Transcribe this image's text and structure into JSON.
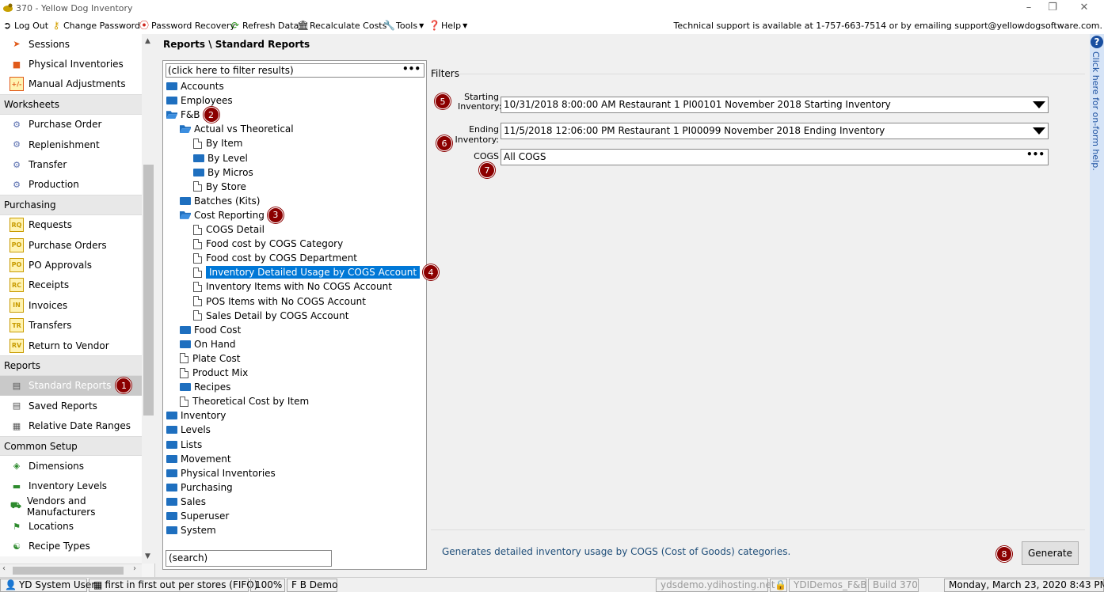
{
  "window": {
    "title": "370  - Yellow Dog Inventory"
  },
  "toolbar": {
    "logout": "Log Out",
    "change_password": "Change Password",
    "password_recovery": "Password Recovery",
    "refresh_data": "Refresh Data",
    "recalculate_costs": "Recalculate Costs",
    "tools": "Tools",
    "help": "Help",
    "support_text": "Technical support is available at 1-757-663-7514 or by emailing support@yellowdogsoftware.com."
  },
  "sidebar": {
    "items": [
      {
        "type": "item",
        "label": "Sessions",
        "icon": "arrow-icon",
        "color": "#e05a1a"
      },
      {
        "type": "item",
        "label": "Physical Inventories",
        "icon": "clipboard-icon",
        "color": "#e05a1a"
      },
      {
        "type": "item",
        "label": "Manual Adjustments",
        "icon": "plus-minus-icon",
        "color": "#e05a1a"
      },
      {
        "type": "header",
        "label": "Worksheets"
      },
      {
        "type": "item",
        "label": "Purchase Order",
        "icon": "worksheet-icon",
        "color": "#5a6fb0"
      },
      {
        "type": "item",
        "label": "Replenishment",
        "icon": "worksheet-icon",
        "color": "#5a6fb0"
      },
      {
        "type": "item",
        "label": "Transfer",
        "icon": "worksheet-icon",
        "color": "#5a6fb0"
      },
      {
        "type": "item",
        "label": "Production",
        "icon": "worksheet-icon",
        "color": "#5a6fb0"
      },
      {
        "type": "header",
        "label": "Purchasing"
      },
      {
        "type": "item",
        "label": "Requests",
        "icon": "rq-icon",
        "color": "#c89b00"
      },
      {
        "type": "item",
        "label": "Purchase Orders",
        "icon": "po-icon",
        "color": "#c89b00"
      },
      {
        "type": "item",
        "label": "PO Approvals",
        "icon": "po-approve-icon",
        "color": "#c89b00"
      },
      {
        "type": "item",
        "label": "Receipts",
        "icon": "rc-icon",
        "color": "#c89b00"
      },
      {
        "type": "item",
        "label": "Invoices",
        "icon": "in-icon",
        "color": "#c89b00"
      },
      {
        "type": "item",
        "label": "Transfers",
        "icon": "tr-icon",
        "color": "#c89b00"
      },
      {
        "type": "item",
        "label": "Return to Vendor",
        "icon": "rv-icon",
        "color": "#c89b00"
      },
      {
        "type": "header",
        "label": "Reports"
      },
      {
        "type": "item",
        "label": "Standard Reports",
        "icon": "report-icon",
        "color": "#555555",
        "selected": true,
        "badge": "1"
      },
      {
        "type": "item",
        "label": "Saved Reports",
        "icon": "saved-report-icon",
        "color": "#555555"
      },
      {
        "type": "item",
        "label": "Relative Date Ranges",
        "icon": "calendar-icon",
        "color": "#555555"
      },
      {
        "type": "header",
        "label": "Common Setup"
      },
      {
        "type": "item",
        "label": "Dimensions",
        "icon": "cube-icon",
        "color": "#2e8b2e"
      },
      {
        "type": "item",
        "label": "Inventory Levels",
        "icon": "levels-icon",
        "color": "#2e8b2e"
      },
      {
        "type": "item",
        "label": "Vendors and Manufacturers",
        "icon": "truck-icon",
        "color": "#2e8b2e"
      },
      {
        "type": "item",
        "label": "Locations",
        "icon": "flag-icon",
        "color": "#2e8b2e"
      },
      {
        "type": "item",
        "label": "Recipe Types",
        "icon": "fork-knife-icon",
        "color": "#2e8b2e"
      }
    ]
  },
  "breadcrumb": "Reports \\ Standard Reports",
  "tree": {
    "filter_placeholder": "(click here to filter results)",
    "search_placeholder": "(search)",
    "rows": [
      {
        "label": "Accounts",
        "kind": "folder",
        "depth": 0
      },
      {
        "label": "Employees",
        "kind": "folder",
        "depth": 0
      },
      {
        "label": "F&B",
        "kind": "folder-open",
        "depth": 0,
        "badge": "2"
      },
      {
        "label": "Actual vs Theoretical",
        "kind": "folder-open",
        "depth": 1
      },
      {
        "label": "By Item",
        "kind": "doc",
        "depth": 2
      },
      {
        "label": "By Level",
        "kind": "folder",
        "depth": 2
      },
      {
        "label": "By Micros",
        "kind": "folder",
        "depth": 2
      },
      {
        "label": "By Store",
        "kind": "doc",
        "depth": 2
      },
      {
        "label": "Batches (Kits)",
        "kind": "folder",
        "depth": 1
      },
      {
        "label": "Cost Reporting",
        "kind": "folder-open",
        "depth": 1,
        "badge": "3"
      },
      {
        "label": "COGS Detail",
        "kind": "doc",
        "depth": 2
      },
      {
        "label": "Food cost by COGS Category",
        "kind": "doc",
        "depth": 2
      },
      {
        "label": "Food cost by COGS Department",
        "kind": "doc",
        "depth": 2
      },
      {
        "label": "Inventory Detailed Usage by COGS Account",
        "kind": "doc",
        "depth": 2,
        "selected": true,
        "badge": "4"
      },
      {
        "label": "Inventory Items with No COGS Account",
        "kind": "doc",
        "depth": 2
      },
      {
        "label": "POS Items with No COGS Account",
        "kind": "doc",
        "depth": 2
      },
      {
        "label": "Sales Detail by COGS Account",
        "kind": "doc",
        "depth": 2
      },
      {
        "label": "Food Cost",
        "kind": "folder",
        "depth": 1
      },
      {
        "label": "On Hand",
        "kind": "folder",
        "depth": 1
      },
      {
        "label": "Plate Cost",
        "kind": "doc",
        "depth": 1
      },
      {
        "label": "Product Mix",
        "kind": "doc",
        "depth": 1
      },
      {
        "label": "Recipes",
        "kind": "folder",
        "depth": 1
      },
      {
        "label": "Theoretical Cost by Item",
        "kind": "doc",
        "depth": 1
      },
      {
        "label": "Inventory",
        "kind": "folder",
        "depth": 0
      },
      {
        "label": "Levels",
        "kind": "folder",
        "depth": 0
      },
      {
        "label": "Lists",
        "kind": "folder",
        "depth": 0
      },
      {
        "label": "Movement",
        "kind": "folder",
        "depth": 0
      },
      {
        "label": "Physical Inventories",
        "kind": "folder",
        "depth": 0
      },
      {
        "label": "Purchasing",
        "kind": "folder",
        "depth": 0
      },
      {
        "label": "Sales",
        "kind": "folder",
        "depth": 0
      },
      {
        "label": "Superuser",
        "kind": "folder",
        "depth": 0
      },
      {
        "label": "System",
        "kind": "folder",
        "depth": 0
      }
    ]
  },
  "filters": {
    "section_label": "Filters",
    "starting_label_1": "Starting",
    "starting_label_2": "Inventory:",
    "starting_value": "10/31/2018 8:00:00 AM Restaurant 1 PI00101 November 2018 Starting Inventory",
    "starting_badge": "5",
    "ending_label": "Ending Inventory:",
    "ending_value": "11/5/2018 12:06:00 PM Restaurant 1 PI00099 November 2018 Ending Inventory",
    "ending_badge": "6",
    "cogs_label": "COGS",
    "cogs_value": "All COGS",
    "cogs_badge": "7"
  },
  "description": "Generates detailed inventory usage by COGS (Cost of Goods) categories.",
  "generate": {
    "label": "Generate",
    "badge": "8"
  },
  "help_strip": {
    "text": "Click here for on-form help."
  },
  "statusbar": {
    "user": "YD System User",
    "costing": "first in first out per stores (FIFO)",
    "zoom": "100%",
    "company": "F B Demo",
    "host": "ydsdemo.ydihosting.net",
    "database": "YDIDemos_F&B",
    "build": "Build 370",
    "datetime": "Monday, March 23, 2020 8:43 PM"
  },
  "colors": {
    "accent": "#0078d7",
    "badge": "#8b0000",
    "folder": "#1e6fbf"
  }
}
